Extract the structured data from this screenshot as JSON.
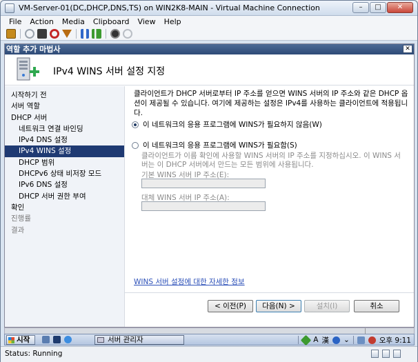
{
  "window": {
    "title": "VM-Server-01(DC,DHCP,DNS,TS) on WIN2K8-MAIN - Virtual Machine Connection",
    "minimize": "–",
    "maximize": "□",
    "close": "✕"
  },
  "menu": [
    "File",
    "Action",
    "Media",
    "Clipboard",
    "View",
    "Help"
  ],
  "toolbar_icons": [
    "ctrl-alt-del-icon",
    "start-icon",
    "turn-off-icon",
    "shutdown-icon",
    "save-icon",
    "pause-icon",
    "reset-icon",
    "snapshot-icon",
    "revert-icon"
  ],
  "wizard": {
    "window_title": "역할 추가 마법사",
    "close": "✕",
    "heading": "IPv4 WINS 서버 설정 지정",
    "nav": [
      {
        "label": "시작하기 전",
        "level": 0,
        "state": "normal"
      },
      {
        "label": "서버 역할",
        "level": 0,
        "state": "normal"
      },
      {
        "label": "DHCP 서버",
        "level": 0,
        "state": "normal"
      },
      {
        "label": "네트워크 연결 바인딩",
        "level": 1,
        "state": "normal"
      },
      {
        "label": "IPv4 DNS 설정",
        "level": 1,
        "state": "normal"
      },
      {
        "label": "IPv4 WINS 설정",
        "level": 1,
        "state": "active"
      },
      {
        "label": "DHCP 범위",
        "level": 1,
        "state": "normal"
      },
      {
        "label": "DHCPv6 상태 비저장 모드",
        "level": 1,
        "state": "normal"
      },
      {
        "label": "IPv6 DNS 설정",
        "level": 1,
        "state": "normal"
      },
      {
        "label": "DHCP 서버 권한 부여",
        "level": 1,
        "state": "normal"
      },
      {
        "label": "확인",
        "level": 0,
        "state": "normal"
      },
      {
        "label": "진행률",
        "level": 0,
        "state": "dim"
      },
      {
        "label": "결과",
        "level": 0,
        "state": "dim"
      }
    ],
    "description": "클라이언트가 DHCP 서버로부터 IP 주소를 얻으면 WINS 서버의 IP 주소와 같은 DHCP 옵션이 제공될 수 있습니다. 여기에 제공하는 설정은 IPv4를 사용하는 클라이언트에 적용됩니다.",
    "option_not_required": "이 네트워크의 응용 프로그램에 WINS가 필요하지 않음(W)",
    "option_required": "이 네트워크의 응용 프로그램에 WINS가 필요함(S)",
    "required_hint": "클라이언트가 이름 확인에 사용할 WINS 서버의 IP 주소를 지정하십시오. 이 WINS 서버는 이 DHCP 서버에서 만드는 모든 범위에 사용됩니다.",
    "primary_label": "기본 WINS 서버 IP 주소(E):",
    "primary_value": "",
    "alternate_label": "대체 WINS 서버 IP 주소(A):",
    "alternate_value": "",
    "help_link": "WINS 서버 설정에 대한 자세한 정보",
    "buttons": {
      "prev": "< 이전(P)",
      "next": "다음(N) >",
      "install": "설치(I)",
      "cancel": "취소"
    }
  },
  "taskbar": {
    "start": "시작",
    "task": "서버 관리자",
    "clock": "오후 9:11"
  },
  "status": {
    "text": "Status: Running"
  }
}
